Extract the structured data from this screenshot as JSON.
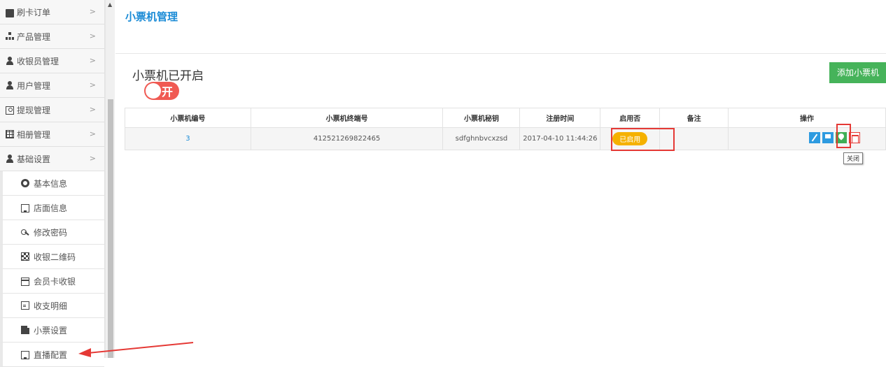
{
  "sidebar": {
    "menu": [
      {
        "label": "刷卡订单",
        "icon": "briefcase-icon"
      },
      {
        "label": "产品管理",
        "icon": "sitemap-icon"
      },
      {
        "label": "收银员管理",
        "icon": "user-icon"
      },
      {
        "label": "用户管理",
        "icon": "user-icon"
      },
      {
        "label": "提现管理",
        "icon": "money-icon"
      },
      {
        "label": "相册管理",
        "icon": "grid-icon"
      },
      {
        "label": "基础设置",
        "icon": "user-icon"
      }
    ],
    "chevron": ">",
    "submenu": [
      {
        "label": "基本信息",
        "icon": "gear-icon"
      },
      {
        "label": "店面信息",
        "icon": "monitor-icon"
      },
      {
        "label": "修改密码",
        "icon": "key-icon"
      },
      {
        "label": "收银二维码",
        "icon": "qrcode-icon"
      },
      {
        "label": "会员卡收银",
        "icon": "card-icon"
      },
      {
        "label": "收支明细",
        "icon": "document-icon"
      },
      {
        "label": "小票设置",
        "icon": "file-icon"
      },
      {
        "label": "直播配置",
        "icon": "monitor-icon"
      }
    ]
  },
  "main": {
    "page_title": "小票机管理",
    "status_title": "小票机已开启",
    "toggle_label": "开",
    "add_button": "添加小票机",
    "table": {
      "headers": [
        "小票机编号",
        "小票机终端号",
        "小票机秘钥",
        "注册时间",
        "启用否",
        "备注",
        "操作"
      ],
      "rows": [
        {
          "id": "3",
          "terminal": "412521269822465",
          "key": "sdfghnbvcxzsd",
          "registered": "2017-04-10 11:44:26",
          "enabled": "已启用",
          "note": ""
        }
      ]
    },
    "tooltip": "关闭"
  },
  "colors": {
    "accent": "#1a8bd6",
    "toggle": "#f05a53",
    "add_button": "#46b35a",
    "badge": "#f5b100",
    "highlight": "#e53935"
  }
}
